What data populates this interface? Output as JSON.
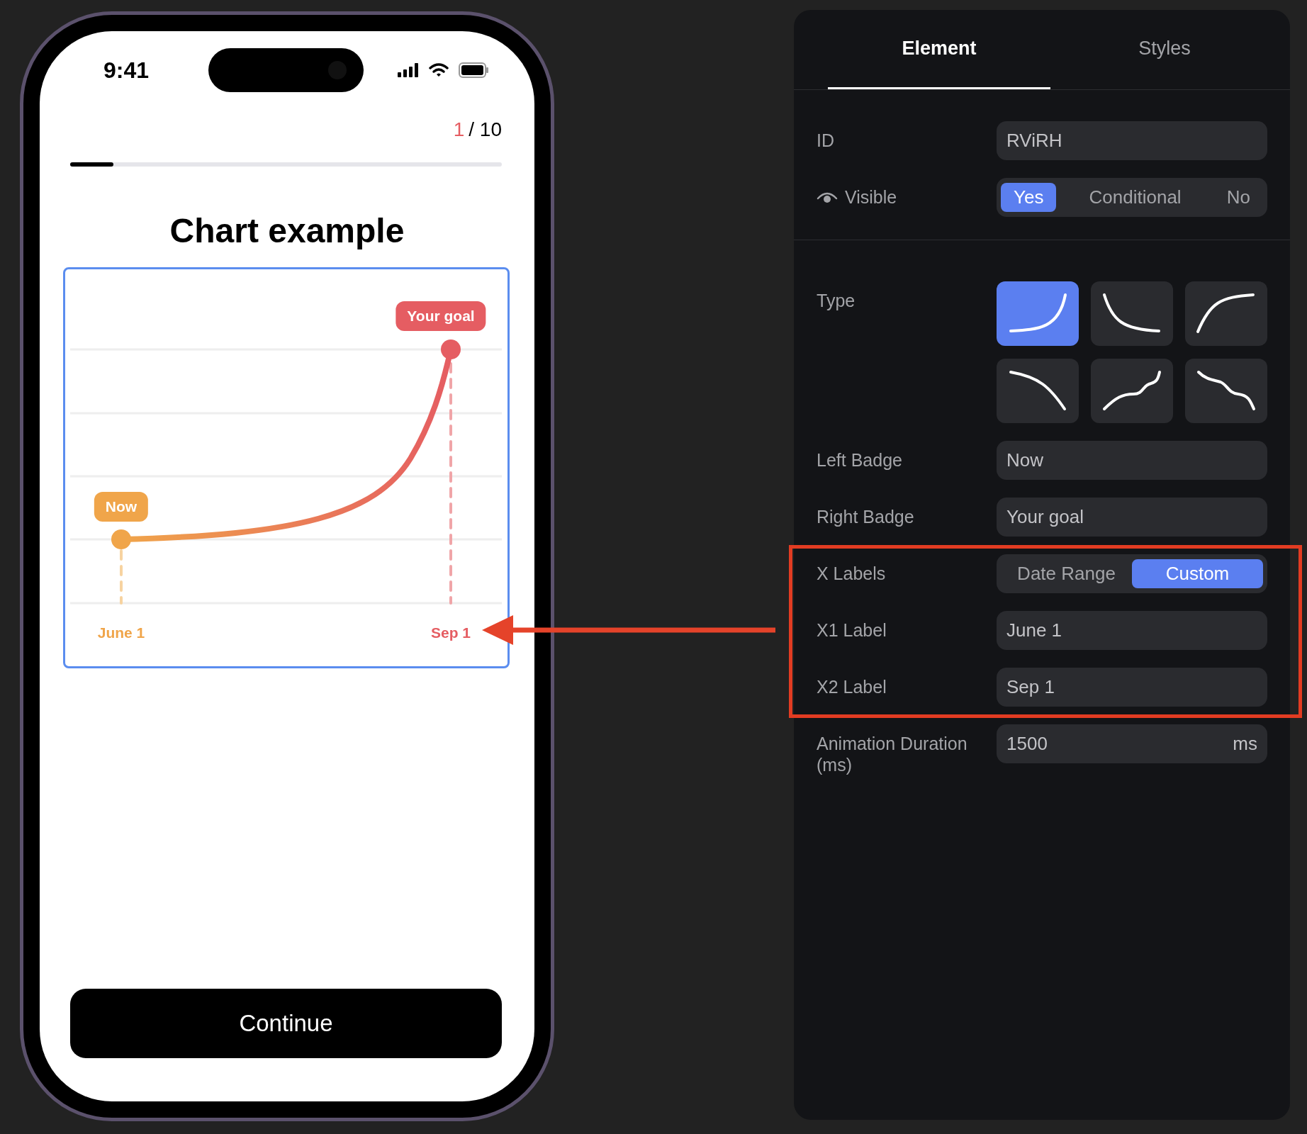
{
  "status_bar": {
    "time": "9:41"
  },
  "progress": {
    "current": "1",
    "total": "/ 10",
    "level": 0.1
  },
  "title": "Chart example",
  "chart": {
    "left_badge": "Now",
    "right_badge": "Your goal",
    "x_labels": [
      "June 1",
      "Sep 1"
    ]
  },
  "continue_button": "Continue",
  "panel": {
    "tabs": [
      {
        "label": "Element",
        "selected": true
      },
      {
        "label": "Styles",
        "selected": false
      }
    ],
    "sections": [
      {
        "rows": [
          {
            "kind": "field",
            "label": "ID",
            "value": "RViRH"
          },
          {
            "kind": "visibility",
            "label": "Visible",
            "options": [
              {
                "label": "Yes",
                "selected": true
              },
              {
                "label": "Conditional",
                "selected": false
              },
              {
                "label": "No",
                "selected": false
              }
            ]
          }
        ]
      },
      {
        "rows": [
          {
            "kind": "curves",
            "label": "Type",
            "options": [
              {
                "kind": "ease-in",
                "selected": true
              },
              {
                "kind": "decay",
                "selected": false
              },
              {
                "kind": "ease-out",
                "selected": false
              },
              {
                "kind": "fall",
                "selected": false
              },
              {
                "kind": "s-rise",
                "selected": false
              },
              {
                "kind": "s-fall",
                "selected": false
              }
            ]
          },
          {
            "kind": "field",
            "label": "Left Badge",
            "value": "Now"
          },
          {
            "kind": "field",
            "label": "Right Badge",
            "value": "Your goal"
          },
          {
            "kind": "highlight_group",
            "rows": [
              {
                "kind": "segmented",
                "label": "X Labels",
                "options": [
                  {
                    "label": "Date Range",
                    "selected": false
                  },
                  {
                    "label": "Custom",
                    "selected": true
                  }
                ]
              },
              {
                "kind": "field",
                "label": "X1 Label",
                "value": "June 1"
              },
              {
                "kind": "field",
                "label": "X2 Label",
                "value": "Sep 1"
              }
            ]
          },
          {
            "kind": "suffix",
            "label": "Animation Duration (ms)",
            "value": "1500",
            "suffix": "ms"
          }
        ]
      }
    ]
  }
}
